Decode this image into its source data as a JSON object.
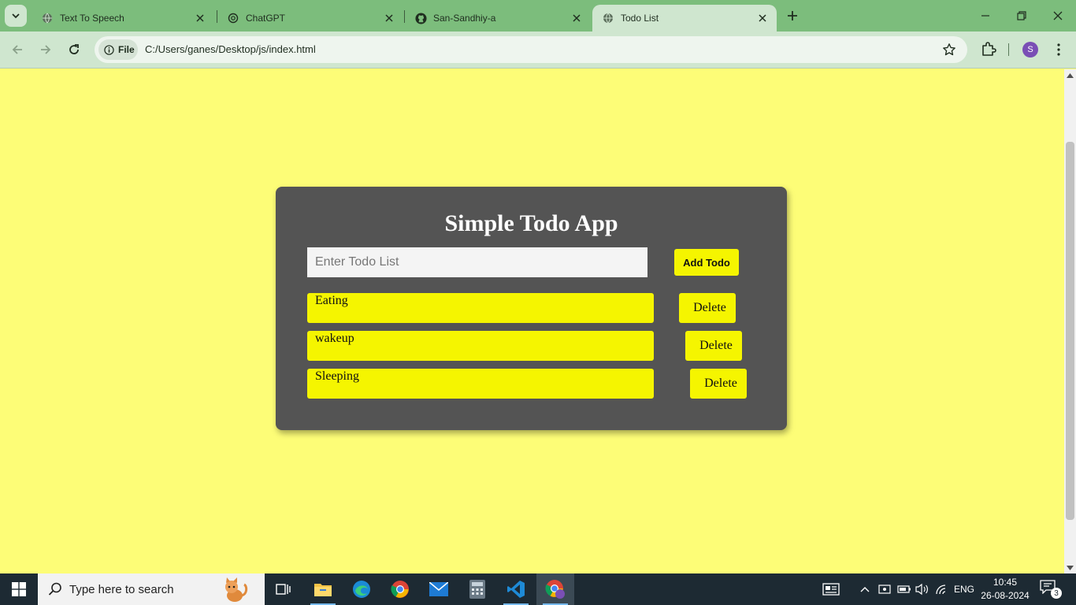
{
  "browser": {
    "tabs": [
      {
        "title": "Text To Speech",
        "icon": "globe-icon",
        "active": false
      },
      {
        "title": "ChatGPT",
        "icon": "chatgpt-icon",
        "active": false
      },
      {
        "title": "San-Sandhiy-a",
        "icon": "github-icon",
        "active": false
      },
      {
        "title": "Todo List",
        "icon": "globe-icon",
        "active": true
      }
    ],
    "address": {
      "chip_label": "File",
      "url": "C:/Users/ganes/Desktop/js/index.html"
    },
    "profile_initial": "S"
  },
  "app": {
    "title": "Simple Todo App",
    "input_placeholder": "Enter Todo List",
    "input_value": "",
    "add_button_label": "Add Todo",
    "todos": [
      {
        "text": "Eating",
        "delete_label": "Delete"
      },
      {
        "text": "wakeup",
        "delete_label": "Delete"
      },
      {
        "text": "Sleeping",
        "delete_label": "Delete"
      }
    ],
    "colors": {
      "page_background": "#fdfd77",
      "card_background": "#545454",
      "accent_yellow": "#f5f500"
    }
  },
  "taskbar": {
    "search_placeholder": "Type here to search",
    "language": "ENG",
    "time": "10:45",
    "date": "26-08-2024",
    "notification_count": "3"
  }
}
